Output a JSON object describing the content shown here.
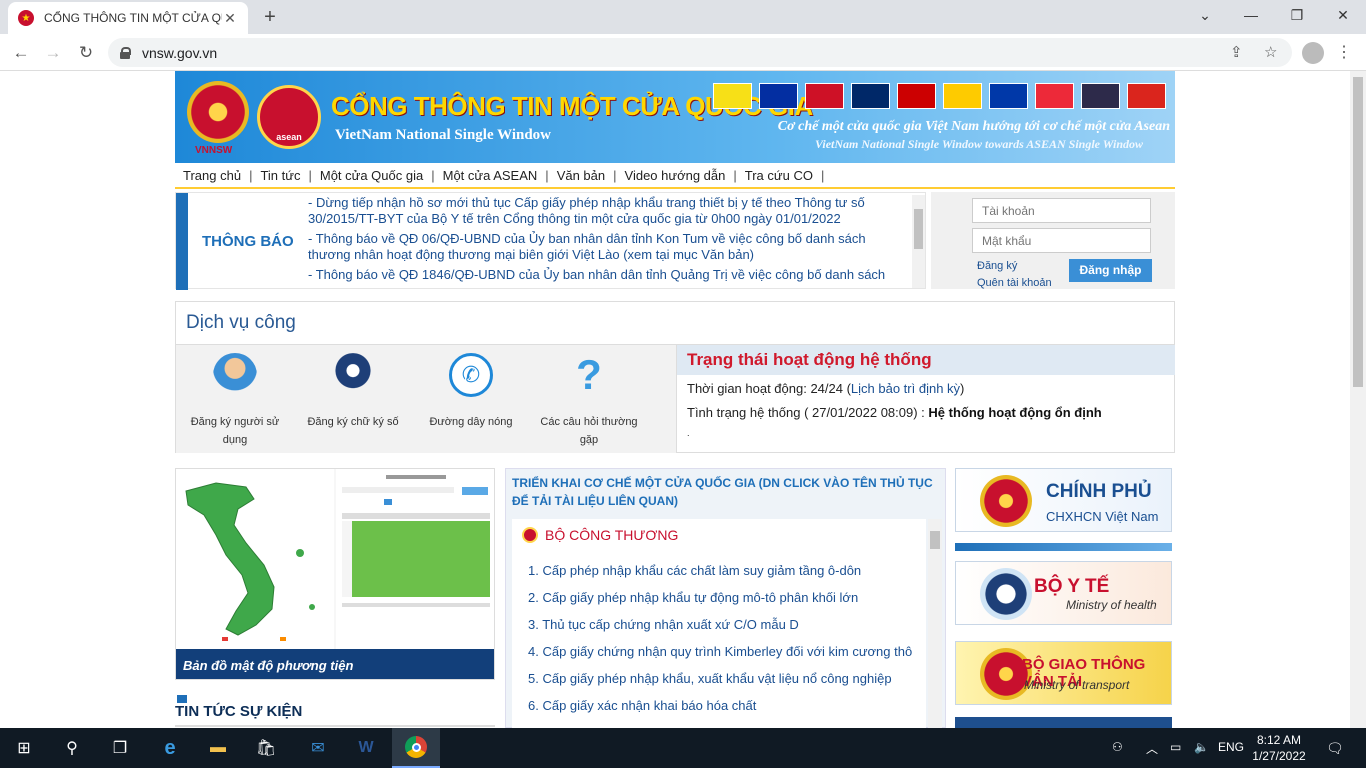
{
  "browser": {
    "tab_title": "CỔNG THÔNG TIN MỘT CỬA QU",
    "url": "vnsw.gov.vn"
  },
  "banner": {
    "vnnsw": "VNNSW",
    "asean": "asean",
    "title": "CỔNG THÔNG TIN MỘT CỬA QUỐC GIA",
    "subtitle": "VietNam National Single Window",
    "slogan": "Cơ chế một cửa quốc gia Việt Nam hướng tới cơ chế một cửa Asean",
    "slogan_en": "VietNam National Single Window towards ASEAN Single Window",
    "flag_colors": [
      "#f7e017",
      "#032ea1",
      "#ce1126",
      "#002868",
      "#cc0001",
      "#fecb00",
      "#0038a8",
      "#ed2939",
      "#2d2a4a",
      "#da251d"
    ]
  },
  "nav": [
    "Trang chủ",
    "Tin tức",
    "Một cửa Quốc gia",
    "Một cửa ASEAN",
    "Văn bản",
    "Video hướng dẫn",
    "Tra cứu CO"
  ],
  "notice": {
    "label": "THÔNG BÁO",
    "items": [
      "- Dừng tiếp nhận hồ sơ mới thủ tục Cấp giấy phép nhập khẩu trang thiết bị y tế theo Thông tư số 30/2015/TT-BYT của Bộ Y tế trên Cổng thông tin một cửa quốc gia từ 0h00 ngày 01/01/2022",
      "- Thông báo về QĐ 06/QĐ-UBND của Ủy ban nhân dân tỉnh Kon Tum về việc công bố danh sách thương nhân hoạt động thương mại biên giới Việt Lào (xem tại mục Văn bản)",
      "- Thông báo về QĐ 1846/QĐ-UBND của Ủy ban nhân dân tỉnh Quảng Trị về việc công bố danh sách"
    ]
  },
  "login": {
    "account_ph": "Tài khoản",
    "password_ph": "Mật khẩu",
    "register": "Đăng ký",
    "forgot": "Quên tài khoản",
    "button": "Đăng nhập"
  },
  "services": {
    "title": "Dịch vụ công",
    "items": [
      "Đăng ký người sử dụng",
      "Đăng ký chữ ký số",
      "Đường dây nóng",
      "Các câu hỏi thường gặp"
    ]
  },
  "status": {
    "title": "Trạng thái hoạt động hệ thống",
    "uptime_label": "Thời gian hoạt động: 24/24 (",
    "uptime_link": "Lịch bảo trì định kỳ",
    "uptime_end": ")",
    "state_label": "Tình trạng hệ thống ( 27/01/2022 08:09) : ",
    "state_value": "Hệ thống hoạt động ổn định",
    "dot": "."
  },
  "map": {
    "caption": "Bản đồ mật độ phương tiện"
  },
  "news": {
    "title": "TIN TỨC SỰ KIỆN"
  },
  "procedures": {
    "header": "TRIỂN KHAI CƠ CHẾ MỘT CỬA QUỐC GIA (DN CLICK VÀO TÊN THỦ TỤC ĐỂ TẢI TÀI LIỆU LIÊN QUAN)",
    "ministry": "BỘ CÔNG THƯƠNG",
    "items": [
      "1. Cấp phép nhập khẩu các chất làm suy giảm tầng ô-dôn",
      "2. Cấp giấy phép nhập khẩu tự động mô-tô phân khối lớn",
      "3. Thủ tục cấp chứng nhận xuất xứ C/O mẫu D",
      "4. Cấp giấy chứng nhận quy trình Kimberley đối với kim cương thô",
      "5. Cấp giấy phép nhập khẩu, xuất khẩu vật liệu nổ công nghiệp",
      "6. Cấp giấy xác nhận khai báo hóa chất"
    ]
  },
  "agencies": [
    {
      "l1": "CHÍNH PHỦ",
      "l2": "CHXHCN Việt Nam"
    },
    {
      "l1": "BỘ Y TẾ",
      "l2": "Ministry of health"
    },
    {
      "l1": "BỘ GIAO THÔNG VẬN TẢI",
      "l2": "Ministry of transport"
    }
  ],
  "taskbar": {
    "lang": "ENG",
    "time": "8:12 AM",
    "date": "1/27/2022"
  }
}
